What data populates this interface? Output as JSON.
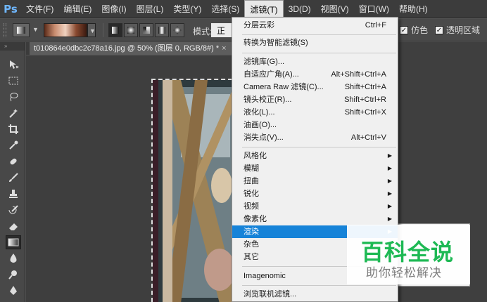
{
  "app": {
    "logo": "Ps"
  },
  "menubar": {
    "items": [
      "文件(F)",
      "编辑(E)",
      "图像(I)",
      "图层(L)",
      "类型(Y)",
      "选择(S)",
      "滤镜(T)",
      "3D(D)",
      "视图(V)",
      "窗口(W)",
      "帮助(H)"
    ],
    "active_index": 6
  },
  "options": {
    "mode_label": "模式:",
    "mode_value": "正常",
    "dither_label": "仿色",
    "dither_checked": true,
    "transparency_label": "透明区域",
    "transparency_checked": true
  },
  "document": {
    "tab_title": "t010864e0dbc2c78a16.jpg @ 50% (图层 0, RGB/8#) *",
    "close_glyph": "×"
  },
  "filter_menu": {
    "last_filter": {
      "label": "分层云彩",
      "shortcut": "Ctrl+F"
    },
    "convert_smart": {
      "label": "转换为智能滤镜(S)"
    },
    "group1": [
      {
        "label": "滤镜库(G)...",
        "shortcut": ""
      },
      {
        "label": "自适应广角(A)...",
        "shortcut": "Alt+Shift+Ctrl+A"
      },
      {
        "label": "Camera Raw 滤镜(C)...",
        "shortcut": "Shift+Ctrl+A"
      },
      {
        "label": "镜头校正(R)...",
        "shortcut": "Shift+Ctrl+R"
      },
      {
        "label": "液化(L)...",
        "shortcut": "Shift+Ctrl+X"
      },
      {
        "label": "油画(O)...",
        "shortcut": ""
      },
      {
        "label": "消失点(V)...",
        "shortcut": "Alt+Ctrl+V"
      }
    ],
    "submenus": [
      {
        "label": "风格化"
      },
      {
        "label": "模糊"
      },
      {
        "label": "扭曲"
      },
      {
        "label": "锐化"
      },
      {
        "label": "视频"
      },
      {
        "label": "像素化"
      },
      {
        "label": "渲染",
        "highlighted": true
      },
      {
        "label": "杂色"
      },
      {
        "label": "其它"
      }
    ],
    "plugin": {
      "label": "Imagenomic"
    },
    "browse": {
      "label": "浏览联机滤镜..."
    }
  },
  "watermark": {
    "title": "百科全说",
    "subtitle": "助你轻松解决"
  },
  "colors": {
    "highlight": "#1683d8",
    "watermark_green": "#1eb954",
    "logo_blue": "#6fb7ff"
  }
}
